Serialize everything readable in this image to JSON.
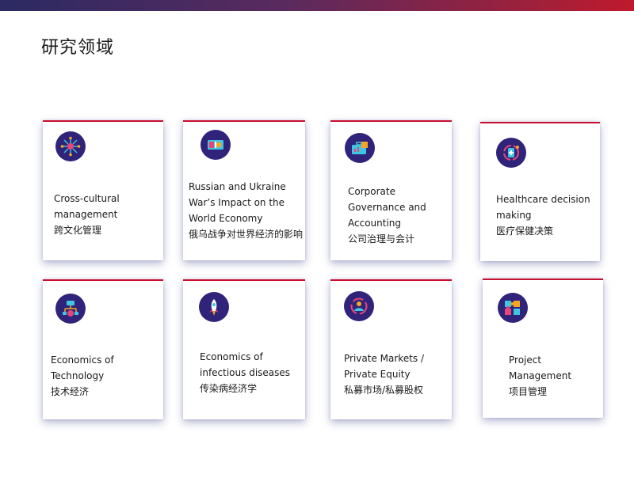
{
  "page": {
    "title": "研究领域"
  },
  "cards": [
    {
      "icon": "network-icon",
      "lines": [
        "Cross-cultural",
        "management",
        "跨文化管理"
      ]
    },
    {
      "icon": "globe-map-icon",
      "lines": [
        "Russian and Ukraine",
        "War’s Impact on the",
        "World Economy",
        "俄乌战争对世界经济的影响"
      ]
    },
    {
      "icon": "briefcase-chart-icon",
      "lines": [
        "Corporate",
        "Governance and",
        "Accounting",
        "公司治理与会计"
      ]
    },
    {
      "icon": "medical-refresh-icon",
      "lines": [
        "Healthcare decision",
        "making",
        "医疗保健决策"
      ]
    },
    {
      "icon": "tech-flow-icon",
      "lines": [
        "Economics of",
        "Technology",
        "技术经济"
      ]
    },
    {
      "icon": "rocket-icon",
      "lines": [
        "Economics of",
        "infectious diseases",
        "传染病经济学"
      ]
    },
    {
      "icon": "user-cycle-icon",
      "lines": [
        "Private Markets /",
        "Private Equity",
        "私募市场/私募股权"
      ]
    },
    {
      "icon": "puzzle-icon",
      "lines": [
        "Project",
        "Management",
        "项目管理"
      ]
    }
  ],
  "colors": {
    "accent_red": "#c8102e",
    "icon_bg": "#2f2479",
    "icon_orange": "#f5a623",
    "icon_pink": "#e8457a",
    "icon_cyan": "#3fc6e0"
  }
}
